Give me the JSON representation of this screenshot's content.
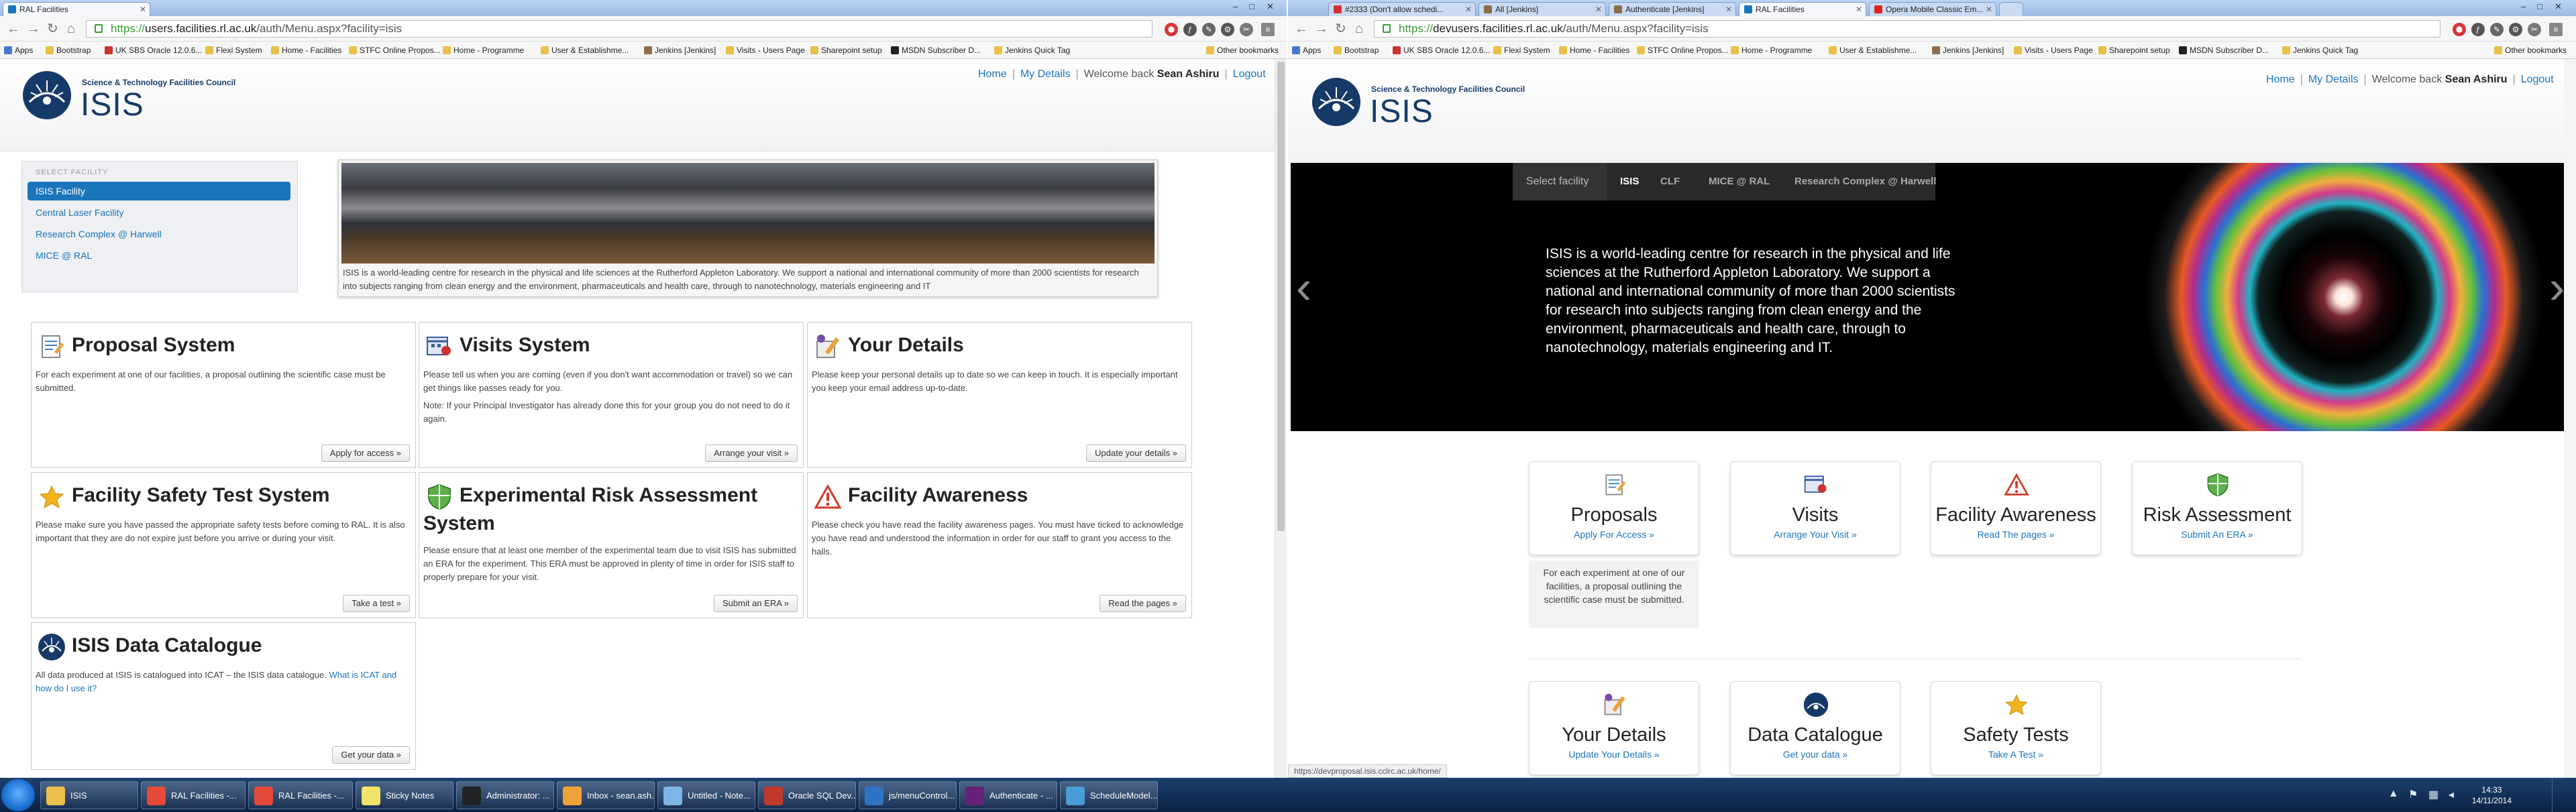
{
  "left_browser": {
    "tabs": [
      {
        "title": "RAL Facilities"
      }
    ],
    "window_controls": [
      "–",
      "□",
      "✕"
    ],
    "nav": {
      "back": "←",
      "forward": "→",
      "reload": "↻",
      "home": "⌂"
    },
    "url": {
      "scheme": "https://",
      "host": "users.facilities.rl.ac.uk",
      "path": "/auth/Menu.aspx?facility=isis"
    },
    "bookmarks": [
      "Apps",
      "Bootstrap",
      "UK SBS Oracle 12.0.6...",
      "Flexi System",
      "Home - Facilities",
      "STFC Online Propos...",
      "Home - Programme",
      "User & Establishme...",
      "Jenkins [Jenkins]",
      "Visits - Users Page",
      "Sharepoint setup",
      "MSDN Subscriber D...",
      "Jenkins Quick Tag"
    ],
    "other_bookmarks": "Other bookmarks",
    "header": {
      "org": "Science & Technology Facilities Council",
      "brand": "ISIS",
      "nav_home": "Home",
      "nav_details": "My Details",
      "welcome": "Welcome back",
      "user": "Sean Ashiru",
      "logout": "Logout"
    },
    "facility_select": {
      "label": "SELECT FACILITY",
      "items": [
        "ISIS Facility",
        "Central Laser Facility",
        "Research Complex @ Harwell",
        "MICE @ RAL"
      ],
      "active": "ISIS Facility"
    },
    "hero_caption": "ISIS is a world-leading centre for research in the physical and life sciences at the Rutherford Appleton Laboratory. We support a national and international community of more than 2000 scientists for research into subjects ranging from clean energy and the environment, pharmaceuticals and health care, through to nanotechnology, materials engineering and IT",
    "cards": [
      {
        "title": "Proposal System",
        "icon": "proposal-icon",
        "text": "For each experiment at one of our facilities, a proposal outlining the scientific case must be submitted.",
        "button": "Apply for access »"
      },
      {
        "title": "Visits System",
        "icon": "visits-icon",
        "text": "Please tell us when you are coming (even if you don't want accommodation or travel) so we can get things like passes ready for you.",
        "note": "Note: If your Principal Investigator has already done this for your group you do not need to do it again.",
        "button": "Arrange your visit »"
      },
      {
        "title": "Your Details",
        "icon": "details-icon",
        "text": "Please keep your personal details up to date so we can keep in touch. It is especially important you keep your email address up-to-date.",
        "button": "Update your details »"
      },
      {
        "title": "Facility Safety Test System",
        "icon": "star-icon",
        "text": "Please make sure you have passed the appropriate safety tests before coming to RAL. It is also important that they are do not expire just before you arrive or during your visit.",
        "button": "Take a test »"
      },
      {
        "title": "Experimental Risk Assessment",
        "title2": "System",
        "icon": "shield-icon",
        "text": "Please ensure that at least one member of the experimental team due to visit ISIS has submitted an ERA for the experiment. This ERA must be approved in plenty of time in order for ISIS staff to properly prepare for your visit.",
        "button": "Submit an ERA »"
      },
      {
        "title": "Facility Awareness",
        "icon": "warning-icon",
        "text": "Please check you have read the facility awareness pages. You must have ticked to acknowledge you have read and understood the information in order for our staff to grant you access to the halls.",
        "button": "Read the pages »"
      },
      {
        "title": "ISIS Data Catalogue",
        "icon": "data-catalogue-icon",
        "text": "All data produced at ISIS is catalogued into ICAT – the ISIS data catalogue.",
        "link": "What is ICAT and how do I use it?",
        "button": "Get your data »"
      }
    ]
  },
  "right_browser": {
    "tabs": [
      {
        "title": "#2333 (Don't allow schedi..."
      },
      {
        "title": "All [Jenkins]"
      },
      {
        "title": "Authenticate [Jenkins]"
      },
      {
        "title": "RAL Facilities"
      },
      {
        "title": "Opera Mobile Classic Em..."
      }
    ],
    "url": {
      "scheme": "https://",
      "host": "devusers.facilities.rl.ac.uk",
      "path": "/auth/Menu.aspx?facility=isis"
    },
    "header": {
      "org": "Science & Technology Facilities Council",
      "brand": "ISIS",
      "nav_home": "Home",
      "nav_details": "My Details",
      "welcome": "Welcome back",
      "user": "Sean Ashiru",
      "logout": "Logout"
    },
    "facility_nav": {
      "label": "Select facility",
      "items": [
        "ISIS",
        "CLF",
        "MICE @ RAL",
        "Research Complex @ Harwell"
      ],
      "active": "ISIS"
    },
    "carousel": {
      "prev": "‹",
      "next": "›",
      "text": "ISIS is a world-leading centre for research in the physical and life sciences at the Rutherford Appleton Laboratory. We support a national and international community of more than 2000 scientists for research into subjects ranging from clean energy and the environment, pharmaceuticals and health care, through to nanotechnology, materials engineering and IT."
    },
    "tiles": [
      {
        "title": "Proposals",
        "link": "Apply For Access »",
        "icon": "proposal-icon"
      },
      {
        "title": "Visits",
        "link": "Arrange Your Visit »",
        "icon": "visits-icon"
      },
      {
        "title": "Facility Awareness",
        "link": "Read The pages »",
        "icon": "warning-icon"
      },
      {
        "title": "Risk Assessment",
        "link": "Submit An ERA »",
        "icon": "shield-icon"
      },
      {
        "title": "Your Details",
        "link": "Update Your Details »",
        "icon": "details-icon"
      },
      {
        "title": "Data Catalogue",
        "link": "Get your data »",
        "icon": "data-catalogue-icon"
      },
      {
        "title": "Safety Tests",
        "link": "Take A Test »",
        "icon": "star-icon"
      }
    ],
    "proposal_description": "For each experiment at one of our facilities, a proposal outlining the scientific case must be submitted.",
    "status_url": "https://devproposal.isis.cclrc.ac.uk/home/"
  },
  "taskbar": {
    "items": [
      {
        "label": "ISIS",
        "icon": "folder-icon",
        "color": "#e8c04a"
      },
      {
        "label": "RAL Facilities -...",
        "icon": "chrome-icon",
        "color": "#e4493a"
      },
      {
        "label": "RAL Facilities -...",
        "icon": "chrome-icon",
        "color": "#e4493a"
      },
      {
        "label": "Sticky Notes",
        "icon": "sticky-notes-icon",
        "color": "#f2e46a"
      },
      {
        "label": "Administrator: ...",
        "icon": "cmd-icon",
        "color": "#222222"
      },
      {
        "label": "Inbox - sean.ash...",
        "icon": "outlook-icon",
        "color": "#f0a23a"
      },
      {
        "label": "Untitled - Note...",
        "icon": "notepad-icon",
        "color": "#7fb4e6"
      },
      {
        "label": "Oracle SQL Dev...",
        "icon": "oracle-icon",
        "color": "#c0392b"
      },
      {
        "label": "js/menuControl...",
        "icon": "editor-icon",
        "color": "#2e74c4"
      },
      {
        "label": "Authenticate - ...",
        "icon": "visual-studio-icon",
        "color": "#68217a"
      },
      {
        "label": "ScheduleModel...",
        "icon": "window-icon",
        "color": "#4a9bd6"
      }
    ],
    "time": "14:33",
    "date": "14/11/2014"
  }
}
